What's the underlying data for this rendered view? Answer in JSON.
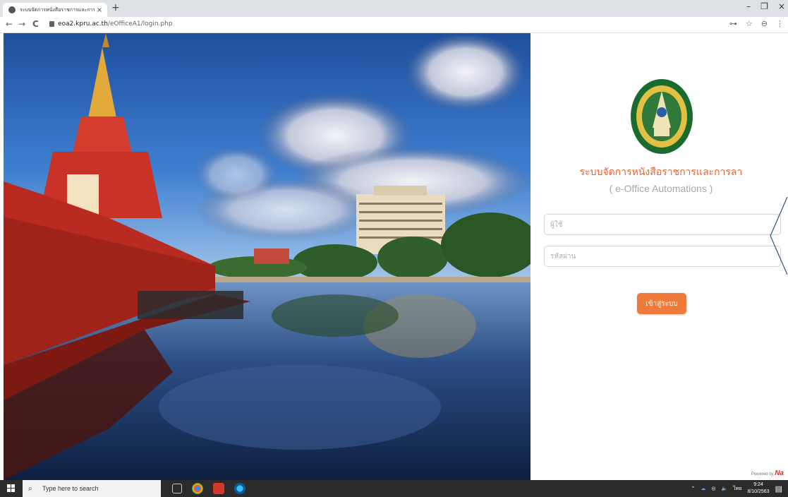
{
  "browser": {
    "tab_title": "ระบบจัดการหนังสือราชการและการลา",
    "tab_close": "×",
    "new_tab": "+",
    "window_minimize": "–",
    "window_maximize": "❐",
    "window_close": "×",
    "back": "←",
    "forward": "→",
    "reload": "C",
    "url_domain": "eoa2.kpru.ac.th",
    "url_path": "/eOfficeA1/login.php",
    "key_icon": "⊶",
    "star_icon": "☆",
    "profile_icon": "⊖",
    "menu_icon": "⋮"
  },
  "login": {
    "system_title": "ระบบจัดการหนังสือราชการและการลา",
    "system_subtitle": "( e-Office Automations )",
    "username_placeholder": "ผู้ใช้",
    "password_placeholder": "รหัสผ่าน",
    "login_button": "เข้าสู่ระบบ",
    "powered_by": "Powered by",
    "powered_brand": "Na"
  },
  "taskbar": {
    "search_placeholder": "Type here to search",
    "language": "ไทย",
    "time": "9:24",
    "date": "8/10/2563"
  },
  "colors": {
    "accent": "#e8632f",
    "button": "#f07a3a",
    "subtitle": "#a7a7a7"
  }
}
